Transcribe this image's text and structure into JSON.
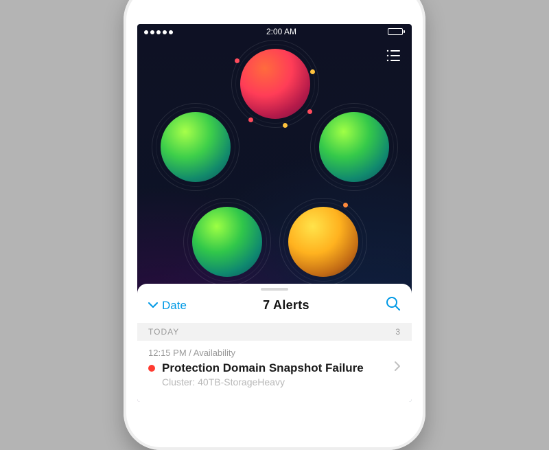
{
  "status_bar": {
    "time": "2:00 AM"
  },
  "sheet": {
    "sort_label": "Date",
    "title": "7 Alerts"
  },
  "section": {
    "label": "TODAY",
    "count": "3"
  },
  "alerts": [
    {
      "meta": "12:15 PM / Availability",
      "title": "Protection Domain Snapshot Failure",
      "subtitle": "Cluster: 40TB-StorageHeavy",
      "severity_color": "#ff3b30"
    }
  ],
  "orbs": [
    {
      "id": "red",
      "status": "critical"
    },
    {
      "id": "g1",
      "status": "ok"
    },
    {
      "id": "g2",
      "status": "ok"
    },
    {
      "id": "g3",
      "status": "ok"
    },
    {
      "id": "amber",
      "status": "warning"
    }
  ]
}
